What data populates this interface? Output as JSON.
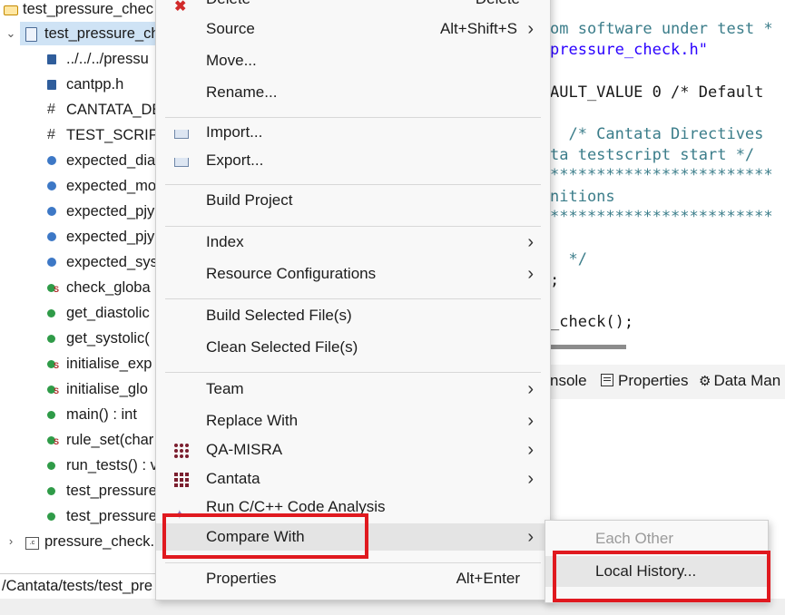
{
  "tree": {
    "items": [
      {
        "label": "test_pressure_chec",
        "icon": "folder-icon",
        "twisty": "",
        "indent": 0
      },
      {
        "label": "test_pressure_ch",
        "icon": "c-source-file-icon",
        "twisty": "⌄",
        "indent": 1,
        "selected": true
      },
      {
        "label": "../../../pressu",
        "icon": "include-icon",
        "indent": 2
      },
      {
        "label": "cantpp.h",
        "icon": "include-icon",
        "indent": 2
      },
      {
        "label": "CANTATA_DE",
        "icon": "macro-icon",
        "indent": 2
      },
      {
        "label": "TEST_SCRIPT",
        "icon": "macro-icon",
        "indent": 2
      },
      {
        "label": "expected_dia",
        "icon": "variable-icon",
        "indent": 2
      },
      {
        "label": "expected_mo",
        "icon": "variable-icon",
        "indent": 2
      },
      {
        "label": "expected_pjy",
        "icon": "variable-icon",
        "indent": 2
      },
      {
        "label": "expected_pjy",
        "icon": "variable-icon",
        "indent": 2
      },
      {
        "label": "expected_sys",
        "icon": "variable-icon",
        "indent": 2
      },
      {
        "label": "check_globa",
        "icon": "static-function-icon",
        "indent": 2
      },
      {
        "label": "get_diastolic",
        "icon": "function-icon",
        "indent": 2
      },
      {
        "label": "get_systolic(",
        "icon": "function-icon",
        "indent": 2
      },
      {
        "label": "initialise_exp",
        "icon": "static-function-icon",
        "indent": 2
      },
      {
        "label": "initialise_glo",
        "icon": "static-function-icon",
        "indent": 2
      },
      {
        "label": "main() : int",
        "icon": "function-icon",
        "indent": 2
      },
      {
        "label": "rule_set(char",
        "icon": "static-function-icon",
        "indent": 2
      },
      {
        "label": "run_tests() : v",
        "icon": "function-icon",
        "indent": 2
      },
      {
        "label": "test_pressure",
        "icon": "function-icon",
        "indent": 2
      },
      {
        "label": "test_pressure",
        "icon": "function-icon",
        "indent": 2
      },
      {
        "label": "pressure_check.",
        "icon": "c-file-icon",
        "twisty": "›",
        "indent": 1
      }
    ]
  },
  "editor": {
    "lines": [
      {
        "text": "om software under test *",
        "cls": "cm"
      },
      {
        "text": "pressure_check.h\"",
        "cls": "str"
      },
      {
        "text": "",
        "cls": "kw"
      },
      {
        "text": "AULT_VALUE 0 /* Default",
        "cls": "kw"
      },
      {
        "text": "",
        "cls": "kw"
      },
      {
        "text": "  /* Cantata Directives",
        "cls": "cm"
      },
      {
        "text": "ta testscript start */",
        "cls": "cm"
      },
      {
        "text": "************************",
        "cls": "cm"
      },
      {
        "text": "nitions",
        "cls": "cm"
      },
      {
        "text": "************************",
        "cls": "cm"
      },
      {
        "text": "",
        "cls": "kw"
      },
      {
        "text": "  */",
        "cls": "cm"
      },
      {
        "text": ";",
        "cls": "kw"
      },
      {
        "text": "",
        "cls": "kw"
      },
      {
        "text": "_check();",
        "cls": "kw"
      }
    ]
  },
  "views": {
    "tabs": [
      {
        "label": "nsole",
        "icon": ""
      },
      {
        "label": "Properties",
        "icon": "properties-icon"
      },
      {
        "label": "Data Man",
        "icon": "gear-icon"
      }
    ]
  },
  "pathbar": {
    "text": "/Cantata/tests/test_pre"
  },
  "menu": {
    "items": [
      {
        "label": "Delete",
        "accel": "Delete",
        "icon": "delete-icon"
      },
      {
        "label": "Source",
        "accel": "Alt+Shift+S",
        "submenu": true
      },
      {
        "label": "Move..."
      },
      {
        "label": "Rename..."
      },
      {
        "sep": true
      },
      {
        "label": "Import...",
        "icon": "import-icon"
      },
      {
        "label": "Export...",
        "icon": "export-icon"
      },
      {
        "sep": true
      },
      {
        "label": "Build Project"
      },
      {
        "sep": true
      },
      {
        "label": "Index",
        "submenu": true
      },
      {
        "label": "Resource Configurations",
        "submenu": true
      },
      {
        "sep": true
      },
      {
        "label": "Build Selected File(s)"
      },
      {
        "label": "Clean Selected File(s)"
      },
      {
        "sep": true
      },
      {
        "label": "Team",
        "submenu": true
      },
      {
        "label": "Replace With",
        "submenu": true
      },
      {
        "label": "QA-MISRA",
        "submenu": true,
        "icon": "qa-misra-icon"
      },
      {
        "label": "Cantata",
        "submenu": true,
        "icon": "cantata-icon"
      },
      {
        "label": "Run C/C++ Code Analysis",
        "icon": "code-analysis-icon"
      },
      {
        "label": "Compare With",
        "submenu": true,
        "highlighted": true
      },
      {
        "sep": true
      },
      {
        "label": "Properties",
        "accel": "Alt+Enter"
      }
    ]
  },
  "submenu": {
    "items": [
      {
        "label": "Each Other",
        "disabled": true
      },
      {
        "label": "Local History...",
        "highlighted": true
      }
    ]
  },
  "colors": {
    "highlight_box": "#e0191f",
    "selection": "#cfe3f5"
  }
}
